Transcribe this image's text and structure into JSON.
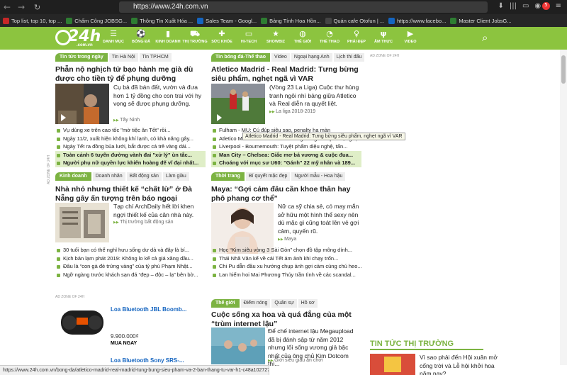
{
  "browser": {
    "url": "https://www.24h.com.vn",
    "back": "←",
    "forward": "→",
    "reload": "↻",
    "badge": "5",
    "bookmarks": [
      {
        "label": "Top list, top 10, top ...",
        "color": "#c62828"
      },
      {
        "label": "Chấm Công JOBSG...",
        "color": "#2e7d32"
      },
      {
        "label": "Thông Tin Xuất Hóa ...",
        "color": "#2e7d32"
      },
      {
        "label": "Sales Team - Googl...",
        "color": "#1565c0"
      },
      {
        "label": "Bảng Tính Hoa Hồn...",
        "color": "#2e7d32"
      },
      {
        "label": "Quán cafe Otofun | ...",
        "color": "#444444"
      },
      {
        "label": "https://www.facebo...",
        "color": "#1565c0"
      },
      {
        "label": "Master Client JobsG...",
        "color": "#2e7d32"
      }
    ]
  },
  "site": {
    "logo_text": "24h",
    "logo_sub": ".com.vn",
    "menu_label": "DANH MỤC",
    "menu": [
      {
        "label": "BÓNG ĐÁ",
        "icon": "⚽"
      },
      {
        "label": "KINH DOANH",
        "icon": "▮"
      },
      {
        "label": "THỊ TRƯỜNG",
        "icon": "⛟"
      },
      {
        "label": "SỨC KHỎE",
        "icon": "✚"
      },
      {
        "label": "HI-TECH",
        "icon": "▭"
      },
      {
        "label": "SHOWBIZ",
        "icon": "★"
      },
      {
        "label": "THẾ GIỚI",
        "icon": "◍"
      },
      {
        "label": "THỂ THAO",
        "icon": "◔"
      },
      {
        "label": "PHÁI ĐẸP",
        "icon": "♀"
      },
      {
        "label": "ÂM THỰC",
        "icon": "ψ"
      },
      {
        "label": "VIDEO",
        "icon": "▶"
      }
    ]
  },
  "news_today": {
    "tabs": [
      "Tin tức trong ngày",
      "Tin Hà Nội",
      "Tin TP.HCM"
    ],
    "headline": "Phẫn nộ nghịch tử bạo hành mẹ già dù được cho tiền tỷ để phụng dưỡng",
    "desc": "Cụ bà đã bán đất, vườn và đưa hơn 1 tỷ đồng cho con trai với hy vọng sẽ được phụng dưỡng.",
    "cat": "Tây Ninh",
    "list": [
      "Vụ dùng xe trên cao tốc \"mờ tiệc ăn Tết\" rồi...",
      "Ngày 11/2, xuất hiện không khí lạnh, có khả năng gây...",
      "Ngày Tết ra đồng bủa lưới, bắt được cá trê vàng dài...",
      "Toàn cảnh 6 tuyến đường vành đai \"xử lý\" ùn tắc...",
      "Người phụ nữ quyền lực khiến hoàng đế vĩ đại nhất..."
    ]
  },
  "football": {
    "tabs": [
      "Tin bóng đá-Thể thao",
      "Video",
      "Ngoại hạng Anh",
      "Lịch thi đấu"
    ],
    "headline": "Atletico Madrid - Real Madrid: Tưng bừng siêu phẩm, nghẹt ngã vì VAR",
    "desc": "(Vòng 23 La Liga) Cuộc thư hùng tranh ngôi nhì bảng giữa Atletico và Real diễn ra quyết liệt.",
    "cat": "La liga 2018-2019",
    "list": [
      "Fulham - MU: Cú đúp siêu sao, penalty ha màn",
      "Atletico Madrid - Real Madrid: Tưng bừng siêu phẩm, nghẹt ngã vì VAR",
      "Liverpool - Bournemouth: Tuyệt phẩm diệu nghệ, tấn...",
      "Man City – Chelsea: Giắc mơ bá vương & cuộc đua...",
      "Choáng với mục sư U60: \"Gánh\" 22 mỹ nhân và 189..."
    ],
    "tooltip": "Atletico Madrid - Real Madrid: Tưng bừng siêu phẩm, nghẹt ngã vì VAR"
  },
  "business": {
    "tabs": [
      "Kinh doanh",
      "Doanh nhân",
      "Bất động sản",
      "Làm giàu"
    ],
    "headline": "Nhà nhỏ nhưng thiết kế “chất lừ” ở Đà Nẵng gây ấn tượng trên báo ngoại",
    "desc": "Tạp chí ArchDaily hết lời khen ngợi thiết kế của căn nhà này.",
    "cat": "Thị trường bất động sản",
    "list": [
      "30 tuổi bạn có thể nghỉ hưu sống dư dả và đây là bí...",
      "Kịch bản lạm phát 2019: Không lo kể cả giá xăng dầu...",
      "Đâu là “con gà đẻ trứng vàng” của tỷ phú Phạm Nhật...",
      "Ngỡ ngàng trước khách sạn đá “đẹp – độc – lạ” bên bờ..."
    ]
  },
  "fashion": {
    "tabs": [
      "Thời trang",
      "Bí quyết mặc đẹp",
      "Người mẫu - Hoa hậu"
    ],
    "headline": "Maya: “Gợi cảm đâu cần khoe thân hay phô phang cơ thể”",
    "desc": "Nữ ca sỹ chia sẻ, có may mắn sở hữu một hình thể sexy nên dù mặc gì cũng toát lên vẻ gợi cảm, quyến rũ.",
    "cat": "Maya",
    "list": [
      "Học “Kim siêu vòng 3 Sài Gòn” chọn đồ tập mông dính...",
      "Thái Nhã Vân kể về cái Tết ám ảnh khi chạy trốn...",
      "Chi Pu dẫn đầu xu hướng chụp ảnh gợi cảm cùng chú heo...",
      "Lan hiếm hoi Mai Phương Thúy trần tình về các scandal..."
    ]
  },
  "world": {
    "tabs": [
      "Thế giới",
      "Điểm nóng",
      "Quân sự",
      "Hồ sơ"
    ],
    "headline": "Cuộc sống xa hoa và quá đẳng của một “trùm internet lậu”",
    "desc": "Để chế internet lậu Megaupload đã bị đánh sập từ năm 2012 nhưng lối sống vương giả bậc nhất của ông chủ Kim Dotcom thì...",
    "cat": "Giới siêu giàu ăn chơi"
  },
  "ads": {
    "zone_label": "AD ZONE OF 24H",
    "product1_name": "Loa Bluetooth JBL Boomb...",
    "product1_price": "9.900.000₫",
    "product1_cta": "MUA NGAY",
    "product2_name": "Loa Bluetooth Sony SRS-..."
  },
  "market": {
    "title": "TIN TỨC THỊ TRƯỜNG",
    "item": "Vì sao phải đến Hội xuân mở cổng trời và Lễ hội khởi hoa năm nay?"
  },
  "status_url": "https://www.24h.com.vn/bong-da/atletico-madrid-real-madrid-tung-bung-sieu-pham-va-2-ban-thang-tu-var-h1-c48a1027273.html"
}
